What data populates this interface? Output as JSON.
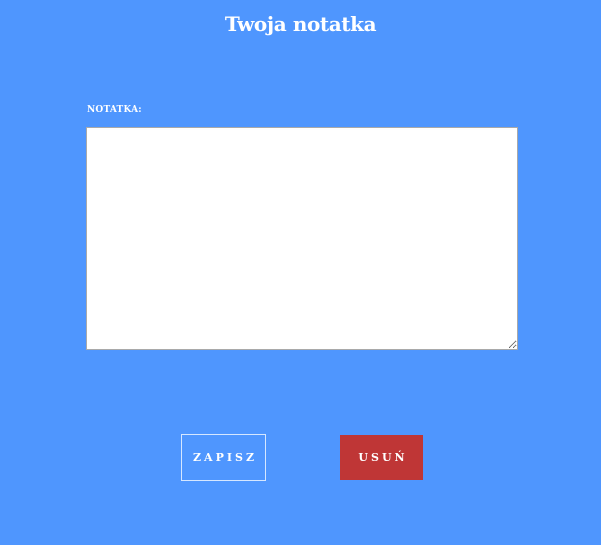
{
  "page": {
    "title": "Twoja notatka"
  },
  "note_form": {
    "label": "NOTATKA:",
    "textarea_value": "",
    "save_label": "ZAPISZ",
    "delete_label": "USUŃ"
  },
  "colors": {
    "background": "#4f96fe",
    "delete_button": "#bf3636",
    "text": "#ffffff"
  }
}
